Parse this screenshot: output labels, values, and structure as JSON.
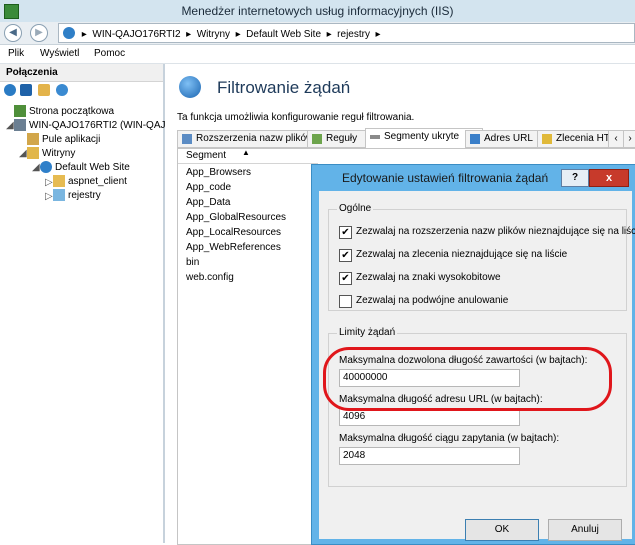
{
  "window": {
    "title": "Menedżer internetowych usług informacyjnych (IIS)"
  },
  "address": {
    "crumbs": [
      "WIN-QAJO176RTI2",
      "Witryny",
      "Default Web Site",
      "rejestry"
    ]
  },
  "menu": {
    "file": "Plik",
    "view": "Wyświetl",
    "help": "Pomoc"
  },
  "connections": {
    "title": "Połączenia",
    "tree": {
      "start_page": "Strona początkowa",
      "server": "WIN-QAJO176RTI2 (WIN-QAJ",
      "app_pools": "Pule aplikacji",
      "sites": "Witryny",
      "default_site": "Default Web Site",
      "aspnet_client": "aspnet_client",
      "rejestry": "rejestry"
    }
  },
  "feature": {
    "title": "Filtrowanie żądań",
    "description": "Ta funkcja umożliwia konfigurowanie reguł filtrowania."
  },
  "tabs": [
    "Rozszerzenia nazw plików",
    "Reguły",
    "Segmenty ukryte",
    "Adres URL",
    "Zlecenia HTT"
  ],
  "segments": {
    "header": "Segment",
    "items": [
      "App_Browsers",
      "App_code",
      "App_Data",
      "App_GlobalResources",
      "App_LocalResources",
      "App_WebReferences",
      "bin",
      "web.config"
    ]
  },
  "dialog": {
    "title": "Edytowanie ustawień filtrowania żądań",
    "help_label": "?",
    "close_label": "x",
    "general": {
      "label": "Ogólne",
      "options": [
        {
          "label": "Zezwalaj na rozszerzenia nazw plików nieznajdujące się na liście",
          "checked": true
        },
        {
          "label": "Zezwalaj na zlecenia nieznajdujące się na liście",
          "checked": true
        },
        {
          "label": "Zezwalaj na znaki wysokobitowe",
          "checked": true
        },
        {
          "label": "Zezwalaj na podwójne anulowanie",
          "checked": false
        }
      ]
    },
    "limits": {
      "label": "Limity żądań",
      "max_content_label": "Maksymalna dozwolona długość zawartości (w bajtach):",
      "max_content_value": "40000000",
      "max_url_label": "Maksymalna długość adresu URL (w bajtach):",
      "max_url_value": "4096",
      "max_query_label": "Maksymalna długość ciągu zapytania (w bajtach):",
      "max_query_value": "2048"
    },
    "ok_label": "OK",
    "cancel_label": "Anuluj"
  }
}
